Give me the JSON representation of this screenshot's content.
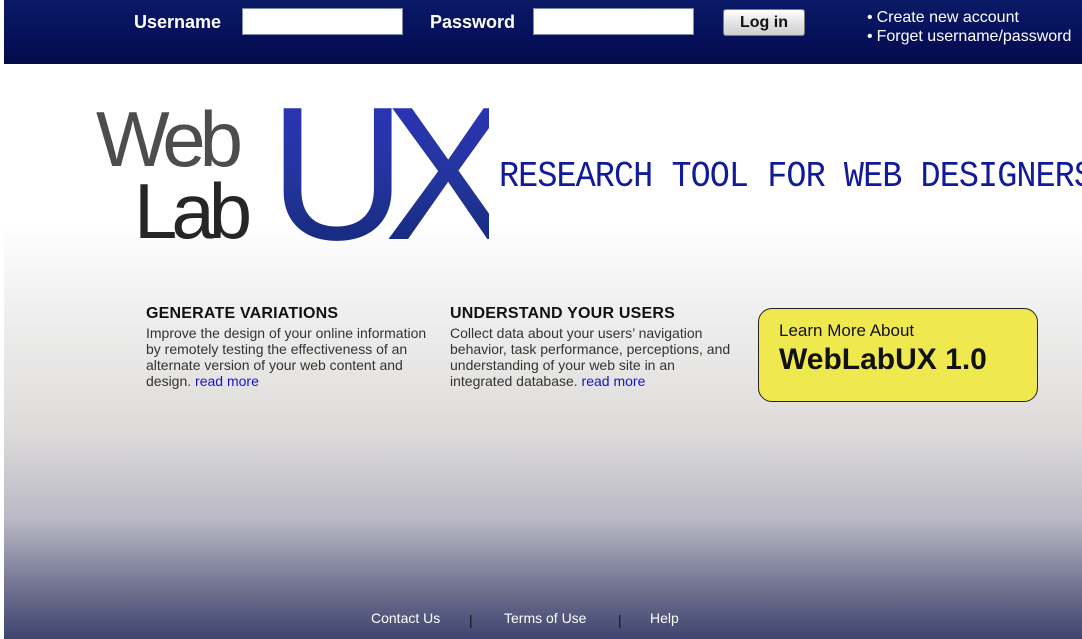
{
  "header": {
    "username_label": "Username",
    "username_value": "",
    "password_label": "Password",
    "password_value": "",
    "login_label": "Log in",
    "links": {
      "create_account": "Create new account",
      "forgot": "Forget username/password"
    },
    "bullet": "•"
  },
  "logo": {
    "web": "Web",
    "lab": "Lab",
    "ux": "UX"
  },
  "tagline": "RESEARCH TOOL FOR WEB DESIGNERS",
  "features": [
    {
      "title": "GENERATE VARIATIONS",
      "text": "Improve the design of your online information by remotely testing the effectiveness of an alternate version of your web content and design.",
      "link": "read more"
    },
    {
      "title": "UNDERSTAND YOUR USERS",
      "text": "Collect data about your users’ navigation behavior, task performance, perceptions, and understanding of your web site in an integrated database.",
      "link": "read more"
    }
  ],
  "learn_more": {
    "small": "Learn More About",
    "big": "WebLabUX 1.0"
  },
  "footer": {
    "contact": "Contact Us",
    "terms": "Terms of Use",
    "help": "Help",
    "separator": "|"
  },
  "colors": {
    "header_bg": "#06105a",
    "tagline": "#111a99",
    "link": "#1414c8",
    "learn_box": "#efe84f",
    "logo_ux": "#252f9e"
  }
}
